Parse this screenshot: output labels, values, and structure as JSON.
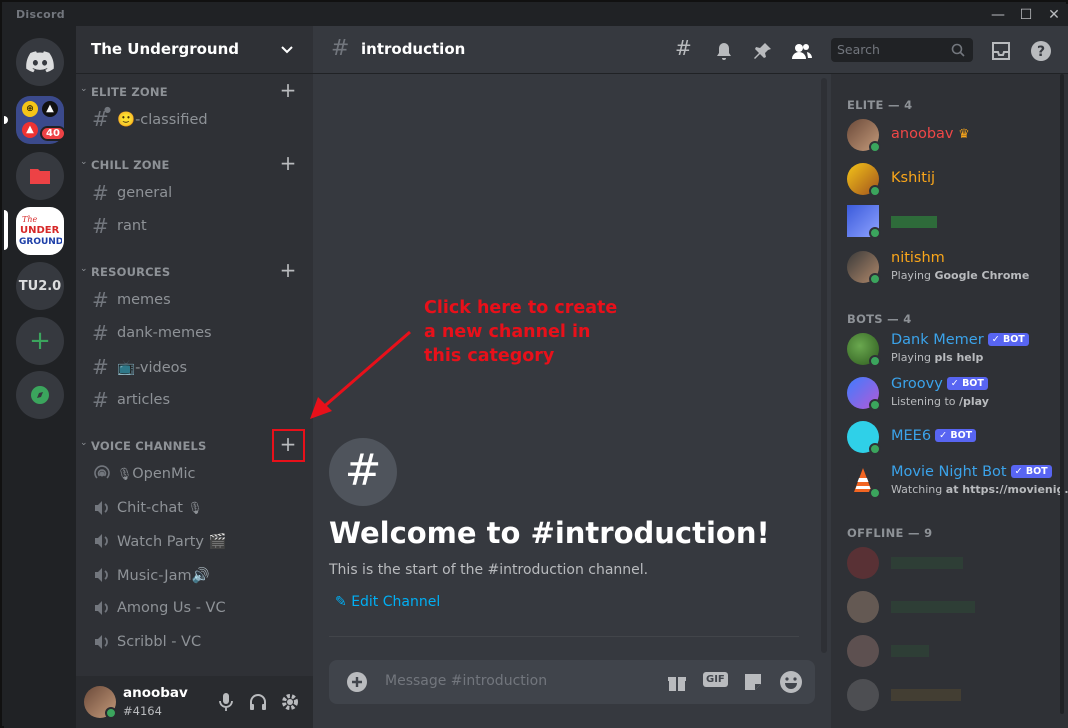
{
  "window": {
    "app_name": "Discord"
  },
  "servers": {
    "badge_count": "40",
    "tu_label": "TU2.0"
  },
  "guild": {
    "name": "The Underground"
  },
  "categories": [
    {
      "label": "ELITE ZONE",
      "channels": [
        {
          "name": "-classified",
          "emoji": "🙂"
        }
      ]
    },
    {
      "label": "CHILL ZONE",
      "channels": [
        {
          "name": "general"
        },
        {
          "name": "rant"
        }
      ]
    },
    {
      "label": "RESOURCES",
      "channels": [
        {
          "name": "memes"
        },
        {
          "name": "dank-memes"
        },
        {
          "name": "-videos",
          "emoji": "📺"
        },
        {
          "name": "articles"
        }
      ]
    },
    {
      "label": "VOICE CHANNELS",
      "channels": [
        {
          "name": "OpenMic"
        },
        {
          "name": "Chit-chat"
        },
        {
          "name": "Watch Party"
        },
        {
          "name": "Music-Jam"
        },
        {
          "name": "Among Us - VC"
        },
        {
          "name": "Scribbl - VC"
        }
      ]
    }
  ],
  "user": {
    "name": "anoobav",
    "tag": "#4164"
  },
  "channel": {
    "name": "introduction"
  },
  "search": {
    "placeholder": "Search"
  },
  "welcome": {
    "title": "Welcome to #introduction!",
    "subtitle": "This is the start of the #introduction channel.",
    "edit_label": "Edit Channel"
  },
  "composer": {
    "placeholder": "Message #introduction",
    "gif_label": "GIF"
  },
  "annotation": {
    "line1": "Click here to create",
    "line2": "a new channel in",
    "line3": "this category"
  },
  "members": {
    "elite_header": "ELITE — 4",
    "elite": [
      {
        "name": "anoobav",
        "color": "#f04747",
        "crown": "♛"
      },
      {
        "name": "Kshitij",
        "color": "#faa61a"
      },
      {
        "name": "",
        "color": "#3ba55d"
      },
      {
        "name": "nitishm",
        "color": "#faa61a",
        "status_prefix": "Playing ",
        "status_bold": "Google Chrome"
      }
    ],
    "bots_header": "BOTS — 4",
    "bots": [
      {
        "name": "Dank Memer",
        "badge": "✓ BOT",
        "status_prefix": "Playing ",
        "status_bold": "pls help"
      },
      {
        "name": "Groovy",
        "badge": "✓ BOT",
        "status_prefix": "Listening to ",
        "status_bold": "/play"
      },
      {
        "name": "MEE6",
        "badge": "✓ BOT"
      },
      {
        "name": "Movie Night Bot",
        "badge": "✓ BOT",
        "status_prefix": "Watching ",
        "status_bold": "at https://movienig..."
      }
    ],
    "offline_header": "OFFLINE — 9"
  },
  "colors": {
    "blurple": "#5865f2",
    "link": "#00aff4",
    "annotation_red": "#e8101a",
    "online": "#3ba55d"
  }
}
